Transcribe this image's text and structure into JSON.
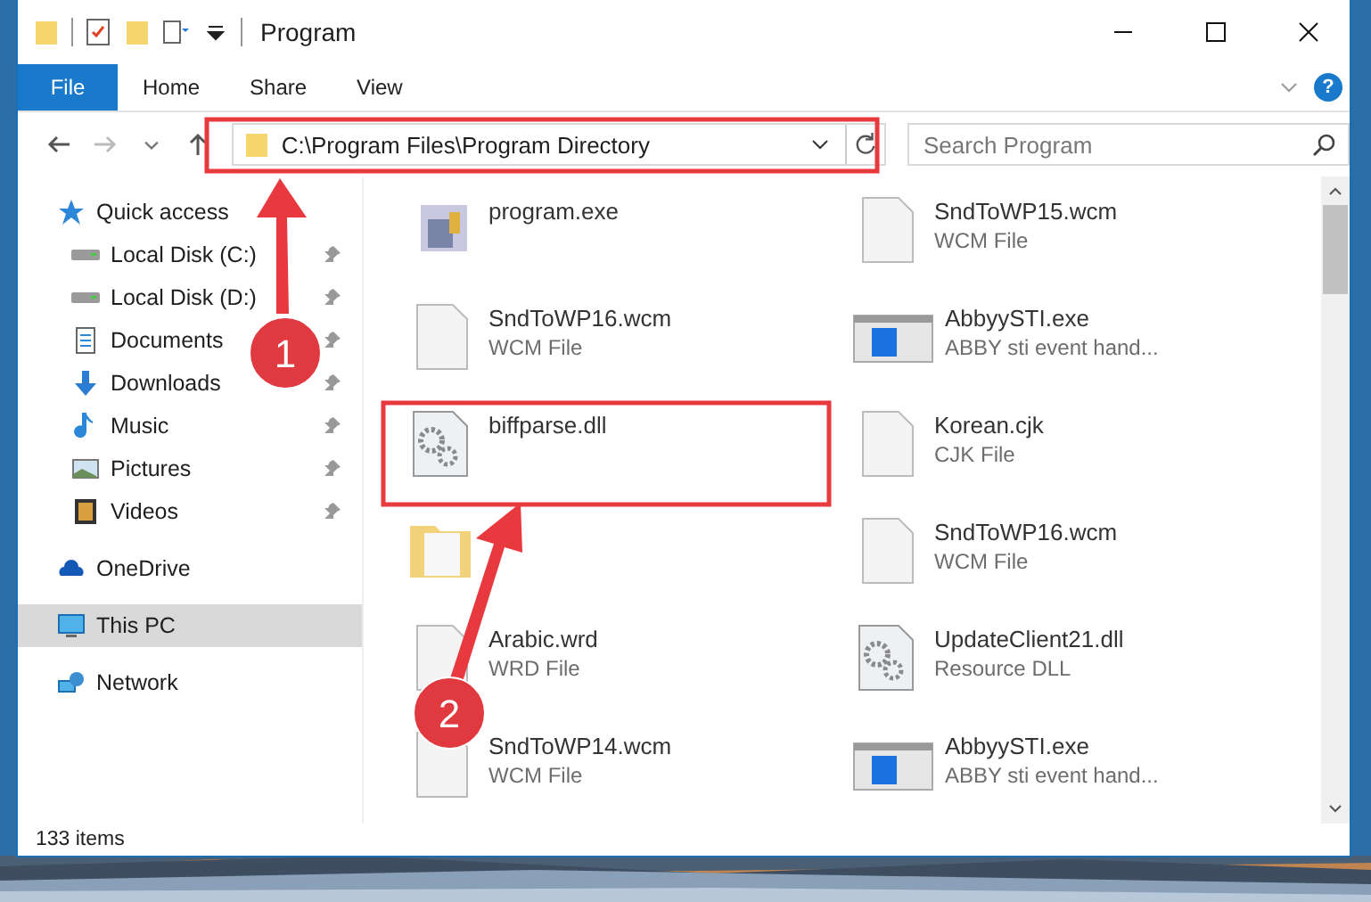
{
  "window": {
    "title": "Program"
  },
  "ribbon": {
    "tabs": [
      {
        "label": "File",
        "selected": true
      },
      {
        "label": "Home",
        "selected": false
      },
      {
        "label": "Share",
        "selected": false
      },
      {
        "label": "View",
        "selected": false
      }
    ],
    "help": "?"
  },
  "address": {
    "path": "C:\\Program Files\\Program Directory"
  },
  "search": {
    "placeholder": "Search Program"
  },
  "nav": [
    {
      "label": "Quick access",
      "kind": "star",
      "selected": false,
      "children": [
        {
          "label": "Local Disk (C:)",
          "kind": "drive",
          "pinned": true,
          "selected": false
        },
        {
          "label": "Local Disk (D:)",
          "kind": "drive",
          "pinned": true,
          "selected": false
        },
        {
          "label": "Documents",
          "kind": "document",
          "pinned": true,
          "selected": false
        },
        {
          "label": "Downloads",
          "kind": "download",
          "pinned": true,
          "selected": false
        },
        {
          "label": "Music",
          "kind": "music",
          "pinned": true,
          "selected": false
        },
        {
          "label": "Pictures",
          "kind": "pictures",
          "pinned": true,
          "selected": false
        },
        {
          "label": "Videos",
          "kind": "videos",
          "pinned": true,
          "selected": false
        }
      ]
    },
    {
      "label": "OneDrive",
      "kind": "cloud",
      "selected": false
    },
    {
      "label": "This PC",
      "kind": "pc",
      "selected": true
    },
    {
      "label": "Network",
      "kind": "network",
      "selected": false
    }
  ],
  "files": [
    {
      "name": "program.exe",
      "kind": "exe"
    },
    {
      "name": "SndToWP16.wcm",
      "type": "WCM File",
      "kind": "file"
    },
    {
      "name": "biffparse.dll",
      "kind": "dll"
    },
    {
      "kind": "folder"
    },
    {
      "name": "Arabic.wrd",
      "type": "WRD File",
      "kind": "file"
    },
    {
      "name": "SndToWP14.wcm",
      "type": "WCM File",
      "kind": "file"
    },
    {
      "name": "SndToWP15.wcm",
      "type": "WCM File",
      "kind": "file"
    },
    {
      "name": "AbbyySTI.exe",
      "type": "ABBY sti event hand...",
      "kind": "app"
    },
    {
      "name": "Korean.cjk",
      "type": "CJK File",
      "kind": "file"
    },
    {
      "name": "SndToWP16.wcm",
      "type": "WCM File",
      "kind": "file"
    },
    {
      "name": "UpdateClient21.dll",
      "type": "Resource DLL",
      "kind": "dll"
    },
    {
      "name": "AbbyySTI.exe",
      "type": "ABBY sti event hand...",
      "kind": "app"
    }
  ],
  "status_bar": {
    "count": "133 items"
  },
  "annotations": [
    {
      "label": "1"
    },
    {
      "label": "2"
    }
  ]
}
